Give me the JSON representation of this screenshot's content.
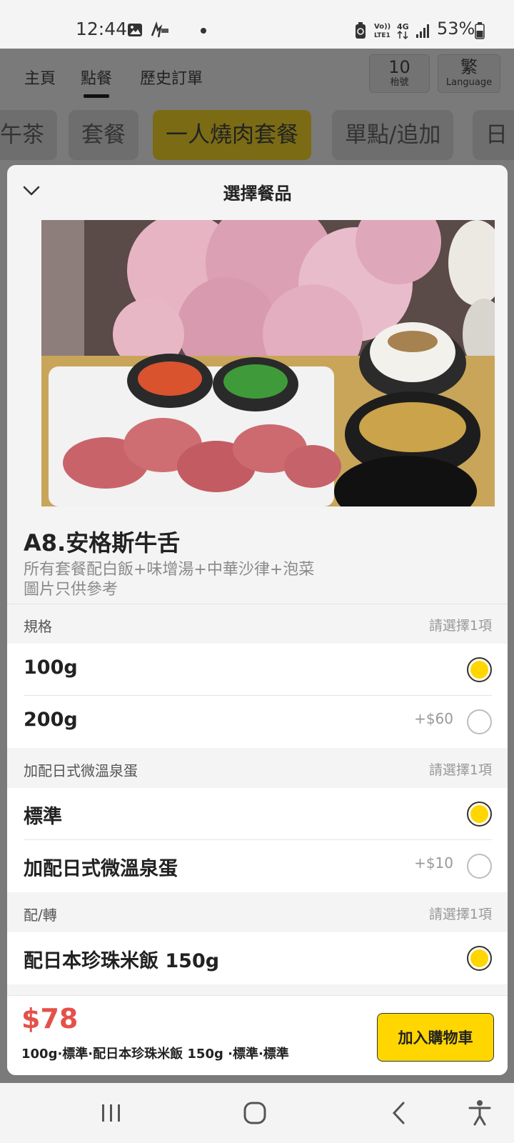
{
  "status_bar": {
    "time": "12:44",
    "battery": "53%",
    "network": "4G",
    "volte": "VoLTE1"
  },
  "background": {
    "nav": [
      "主頁",
      "點餐",
      "歷史訂單"
    ],
    "table_number": "10",
    "table_label": "枱號",
    "lang_char": "繁",
    "lang_label": "Language",
    "categories": [
      "午茶",
      "套餐",
      "一人燒肉套餐",
      "單點/追加",
      "日"
    ]
  },
  "modal": {
    "title": "選擇餐品",
    "item_name": "A8.安格斯牛舌",
    "description_line1": "所有套餐配白飯+味增湯+中華沙律+泡菜",
    "description_line2": "圖片只供參考",
    "groups": [
      {
        "title": "規格",
        "hint": "請選擇1項",
        "options": [
          {
            "label": "100g",
            "price": "",
            "selected": true
          },
          {
            "label": "200g",
            "price": "+$60",
            "selected": false
          }
        ]
      },
      {
        "title": "加配日式微溫泉蛋",
        "hint": "請選擇1項",
        "options": [
          {
            "label": "標準",
            "price": "",
            "selected": true
          },
          {
            "label": "加配日式微溫泉蛋",
            "price": "+$10",
            "selected": false
          }
        ]
      },
      {
        "title": "配/轉",
        "hint": "請選擇1項",
        "options": [
          {
            "label": "配日本珍珠米飯 150g",
            "price": "",
            "selected": true
          }
        ]
      }
    ],
    "footer": {
      "total": "$78",
      "summary": "100g·標準·配日本珍珠米飯 150g ·標準·標準",
      "add_button": "加入購物車"
    }
  },
  "colors": {
    "accent": "#ffd600",
    "price_red": "#e4514a",
    "overlay": "#7a7a7a"
  },
  "icons": {
    "collapse": "chevron-down-icon",
    "sys_recent": "recent-apps-icon",
    "sys_home": "home-icon",
    "sys_back": "back-icon",
    "sys_accessibility": "accessibility-icon"
  }
}
